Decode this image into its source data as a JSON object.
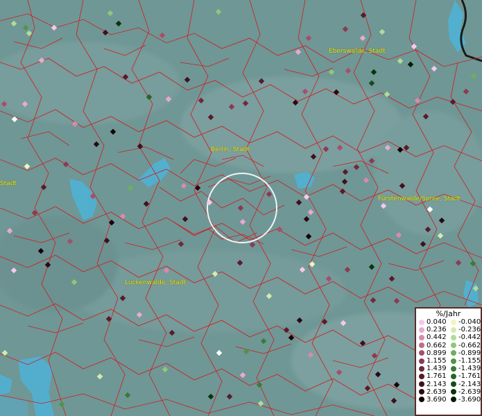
{
  "map": {
    "cities": [
      {
        "name": "Eberswalde, Stadt"
      },
      {
        "name": "Berlin, Stadt"
      },
      {
        "name": "Fürstenwalde/Spree, Stadt"
      },
      {
        "name": "Luckenwalde, Stadt"
      },
      {
        "name": "Stadt"
      }
    ]
  },
  "legend": {
    "title": "%/Jahr",
    "positive": [
      {
        "label": "0.040",
        "color": "#f8c8ea"
      },
      {
        "label": "0.236",
        "color": "#eca8cf"
      },
      {
        "label": "0.442",
        "color": "#d98aae"
      },
      {
        "label": "0.662",
        "color": "#c06a8b"
      },
      {
        "label": "0.899",
        "color": "#a84e6a"
      },
      {
        "label": "1.155",
        "color": "#8c3a52"
      },
      {
        "label": "1.439",
        "color": "#72283c"
      },
      {
        "label": "1.761",
        "color": "#5a1a2a"
      },
      {
        "label": "2.143",
        "color": "#40101c"
      },
      {
        "label": "2.639",
        "color": "#2a0810"
      },
      {
        "label": "3.690",
        "color": "#140206"
      }
    ],
    "negative": [
      {
        "label": "-0.040",
        "color": "#f4f4c0"
      },
      {
        "label": "-0.236",
        "color": "#d2ecae"
      },
      {
        "label": "-0.442",
        "color": "#b0dc96"
      },
      {
        "label": "-0.662",
        "color": "#8ec878"
      },
      {
        "label": "-0.899",
        "color": "#6cb05e"
      },
      {
        "label": "-1.155",
        "color": "#4e9646"
      },
      {
        "label": "-1.439",
        "color": "#387c34"
      },
      {
        "label": "-1.761",
        "color": "#266424"
      },
      {
        "label": "-2.143",
        "color": "#164c16"
      },
      {
        "label": "-2.639",
        "color": "#0a340a"
      },
      {
        "label": "-3.690",
        "color": "#021c02"
      }
    ]
  }
}
